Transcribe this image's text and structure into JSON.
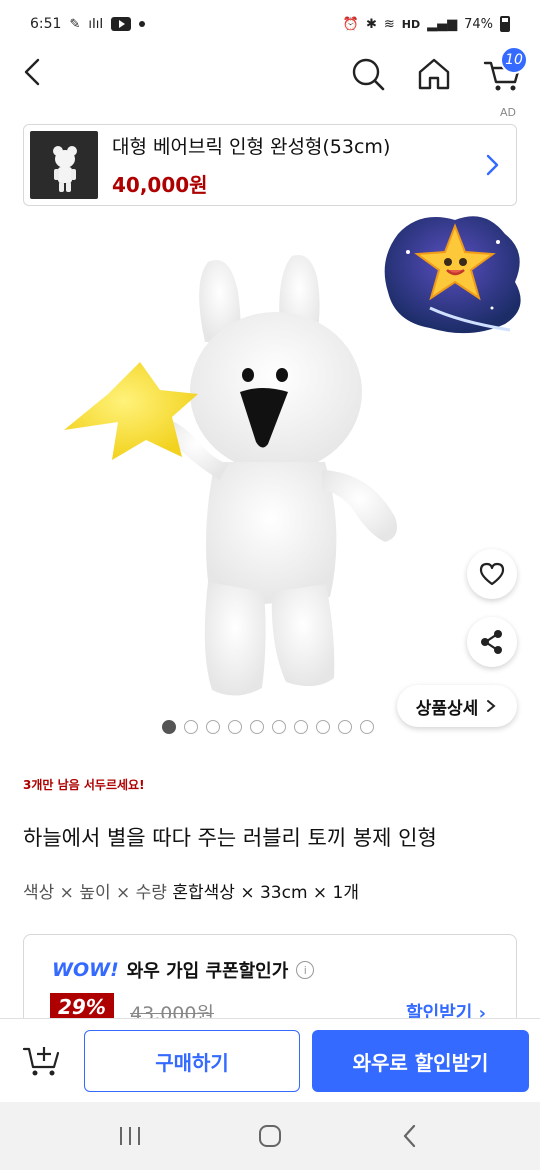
{
  "status_bar": {
    "time": "6:51",
    "battery": "74%",
    "network": "HD",
    "icons": [
      "signal-icon",
      "youtube-icon",
      "alarm-icon",
      "bluetooth-icon",
      "wifi-icon",
      "battery-icon"
    ]
  },
  "header": {
    "cart_count": "10",
    "icons": [
      "back-arrow-icon",
      "search-icon",
      "home-icon",
      "cart-icon"
    ]
  },
  "ad": {
    "tag": "AD",
    "title": "대형 베어브릭 인형 완성형(53cm)",
    "price": "40,000원"
  },
  "gallery": {
    "total_images": 10,
    "active_index": 0
  },
  "actions": {
    "detail_label": "상품상세"
  },
  "product": {
    "stock_notice": "3개만 남음 서두르세요!",
    "title": "하늘에서 별을 따다 주는 러블리 토끼 봉제 인형",
    "option_label": "색상 × 높이 × 수량",
    "option_value": "혼합색상 × 33cm × 1개"
  },
  "wow": {
    "logo": "WOW!",
    "title": "와우 가입 쿠폰할인가",
    "discount": "29%",
    "original_price": "43,000원",
    "link_label": "할인받기 ›"
  },
  "bottom": {
    "buy_label": "구매하기",
    "wow_label": "와우로 할인받기"
  },
  "colors": {
    "accent": "#346aff",
    "price_red": "#ae0000"
  }
}
